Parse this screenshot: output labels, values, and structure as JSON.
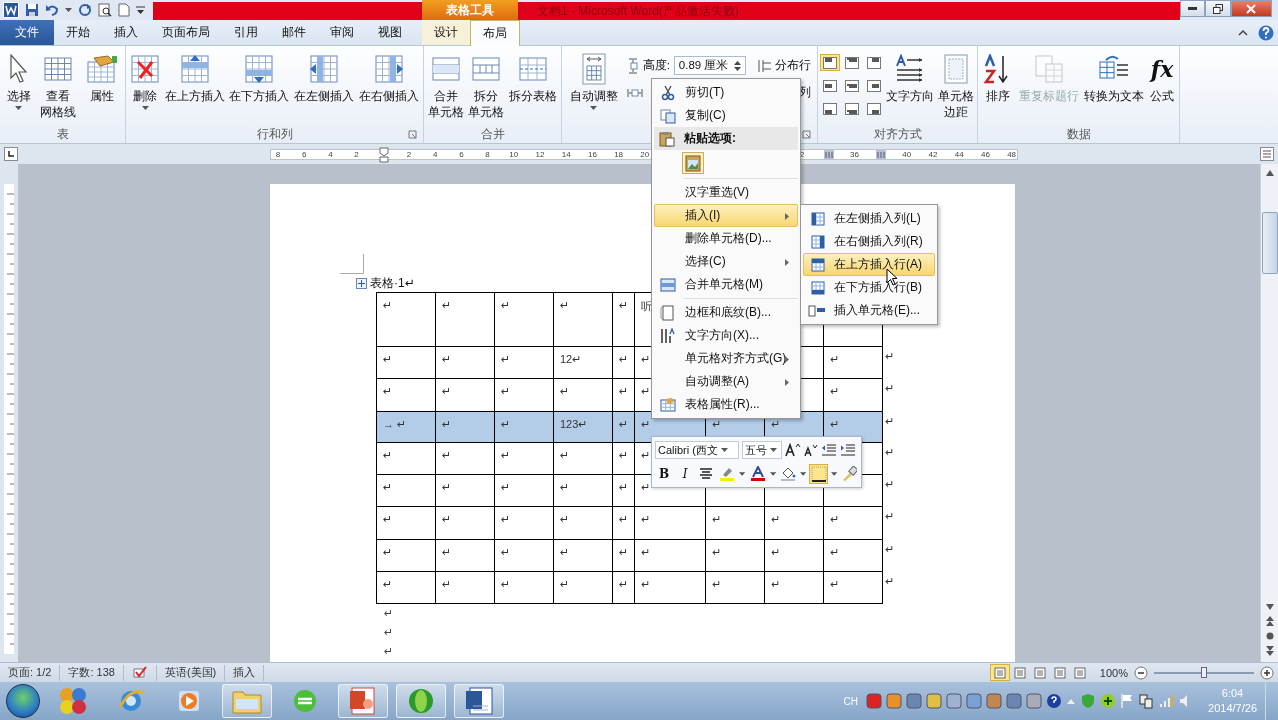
{
  "title_bar": {
    "context_label": "表格工具",
    "title": "文档1 - Microsoft Word(产品激活失败)"
  },
  "tabs": [
    {
      "label": "文件",
      "kind": "file",
      "selected": false
    },
    {
      "label": "开始",
      "kind": "normal",
      "selected": false
    },
    {
      "label": "插入",
      "kind": "normal",
      "selected": false
    },
    {
      "label": "页面布局",
      "kind": "normal",
      "selected": false
    },
    {
      "label": "引用",
      "kind": "normal",
      "selected": false
    },
    {
      "label": "邮件",
      "kind": "normal",
      "selected": false
    },
    {
      "label": "审阅",
      "kind": "normal",
      "selected": false
    },
    {
      "label": "视图",
      "kind": "normal",
      "selected": false
    },
    {
      "label": "设计",
      "kind": "contextual",
      "selected": false
    },
    {
      "label": "布局",
      "kind": "contextual",
      "selected": true
    }
  ],
  "ribbon": {
    "groups": [
      {
        "kind": "buttons",
        "label": "表",
        "launcher": false,
        "buttons": [
          {
            "label": "选择",
            "dropdown": true
          },
          {
            "label_lines": [
              "查看",
              "网格线"
            ]
          },
          {
            "label": "属性"
          }
        ]
      },
      {
        "kind": "buttons",
        "label": "行和列",
        "launcher": true,
        "buttons": [
          {
            "label": "删除",
            "dropdown": true
          },
          {
            "label": "在上方插入"
          },
          {
            "label": "在下方插入"
          },
          {
            "label": "在左侧插入"
          },
          {
            "label": "在右侧插入"
          }
        ]
      },
      {
        "kind": "buttons",
        "label": "合并",
        "launcher": false,
        "buttons": [
          {
            "label_lines": [
              "合并",
              "单元格"
            ]
          },
          {
            "label_lines": [
              "拆分",
              "单元格"
            ]
          },
          {
            "label": "拆分表格"
          }
        ]
      },
      {
        "kind": "cellsize",
        "launcher": true,
        "buttons": [
          {
            "label": "自动调整",
            "dropdown": true
          }
        ],
        "height_label": "高度:",
        "height_value": "0.89 厘米",
        "distribute_rows": "分布行",
        "distribute_cols": "列"
      },
      {
        "kind": "align",
        "label": "对齐方式",
        "launcher": false,
        "align_buttons": [
          {
            "selected": true
          },
          {
            "selected": false
          },
          {
            "selected": false
          },
          {
            "selected": false
          },
          {
            "selected": false
          },
          {
            "selected": false
          },
          {
            "selected": false
          },
          {
            "selected": false
          },
          {
            "selected": false
          }
        ],
        "buttons": [
          {
            "label": "文字方向"
          },
          {
            "label_lines": [
              "单元格",
              "边距"
            ]
          }
        ]
      },
      {
        "kind": "buttons",
        "label": "数据",
        "launcher": false,
        "buttons": [
          {
            "label": "排序",
            "disabled": false
          },
          {
            "label": "重复标题行",
            "disabled": true
          },
          {
            "label": "转换为文本",
            "disabled": false
          },
          {
            "label": "公式",
            "glyph": "fx",
            "disabled": false
          }
        ]
      }
    ]
  },
  "ruler": {
    "segments": [
      [
        "8",
        "6",
        "4",
        "2"
      ],
      [
        "2",
        "4",
        "6",
        "8",
        "10",
        "12",
        "14",
        "16",
        "18",
        "20"
      ],
      [
        "2"
      ],
      [
        "36"
      ],
      [
        "40",
        "42",
        "44",
        "46",
        "48"
      ]
    ]
  },
  "document": {
    "caption": "表格·1↵",
    "table": {
      "rows": [
        {
          "selected": false,
          "cells": [
            "↵",
            "↵",
            "↵",
            "↵",
            "↵",
            "听",
            null,
            null,
            null
          ],
          "end_mark": null
        },
        {
          "selected": false,
          "cells": [
            "↵",
            "↵",
            "↵",
            "12↵",
            "↵",
            "↵",
            null,
            null,
            "↵"
          ],
          "end_mark": "↵"
        },
        {
          "selected": false,
          "cells": [
            "↵",
            "↵",
            "↵",
            "↵",
            "↵",
            "↵",
            null,
            null,
            "↵"
          ],
          "end_mark": "↵"
        },
        {
          "selected": true,
          "cells": [
            "→ ↵",
            "↵",
            "↵",
            "123↵",
            "↵",
            "↵",
            "↵",
            "↵",
            "↵"
          ],
          "end_mark": "↵"
        },
        {
          "selected": false,
          "cells": [
            "↵",
            "↵",
            "↵",
            "↵",
            "↵",
            "↵",
            null,
            null,
            null
          ],
          "end_mark": "↵"
        },
        {
          "selected": false,
          "cells": [
            "↵",
            "↵",
            "↵",
            "↵",
            "↵",
            "↵",
            null,
            null,
            null
          ],
          "end_mark": "↵"
        },
        {
          "selected": false,
          "cells": [
            "↵",
            "↵",
            "↵",
            "↵",
            "↵",
            "↵",
            "↵",
            "↵",
            "↵"
          ],
          "end_mark": "↵"
        },
        {
          "selected": false,
          "cells": [
            "↵",
            "↵",
            "↵",
            "↵",
            "↵",
            "↵",
            "↵",
            "↵",
            "↵"
          ],
          "end_mark": "↵"
        },
        {
          "selected": false,
          "cells": [
            "↵",
            "↵",
            "↵",
            "↵",
            "↵",
            "↵",
            "↵",
            "↵",
            "↵"
          ],
          "end_mark": "↵"
        }
      ]
    },
    "after_marks": [
      "↵",
      "↵",
      "↵"
    ]
  },
  "context_menu": {
    "items": [
      {
        "kind": "item",
        "label": "剪切(T)",
        "selected": false,
        "submenu": false
      },
      {
        "kind": "item",
        "label": "复制(C)",
        "selected": false,
        "submenu": false
      },
      {
        "kind": "header",
        "label": "粘贴选项:"
      },
      {
        "kind": "paste_options"
      },
      {
        "kind": "separator"
      },
      {
        "kind": "item",
        "label": "汉字重选(V)",
        "selected": false,
        "submenu": false
      },
      {
        "kind": "item",
        "label": "插入(I)",
        "selected": true,
        "submenu": true
      },
      {
        "kind": "item",
        "label": "删除单元格(D)...",
        "selected": false,
        "submenu": false
      },
      {
        "kind": "item",
        "label": "选择(C)",
        "selected": false,
        "submenu": true
      },
      {
        "kind": "item",
        "label": "合并单元格(M)",
        "selected": false,
        "submenu": false
      },
      {
        "kind": "separator"
      },
      {
        "kind": "item",
        "label": "边框和底纹(B)...",
        "selected": false,
        "submenu": false
      },
      {
        "kind": "item",
        "label": "文字方向(X)...",
        "selected": false,
        "submenu": false
      },
      {
        "kind": "item",
        "label": "单元格对齐方式(G)",
        "selected": false,
        "submenu": true
      },
      {
        "kind": "item",
        "label": "自动调整(A)",
        "selected": false,
        "submenu": true
      },
      {
        "kind": "item",
        "label": "表格属性(R)...",
        "selected": false,
        "submenu": false
      }
    ]
  },
  "submenu": {
    "items": [
      {
        "label": "在左侧插入列(L)",
        "selected": false
      },
      {
        "label": "在右侧插入列(R)",
        "selected": false
      },
      {
        "label": "在上方插入行(A)",
        "selected": true
      },
      {
        "label": "在下方插入行(B)",
        "selected": false
      },
      {
        "label": "插入单元格(E)...",
        "selected": false
      }
    ]
  },
  "mini_toolbar": {
    "font": "Calibri (西文",
    "size": "五号",
    "format_buttons": [
      {
        "label": "B",
        "selected": false
      },
      {
        "label": "I",
        "selected": false
      }
    ],
    "tool_buttons": [
      {
        "selected": false,
        "dropdown": false
      },
      {
        "selected": false,
        "dropdown": true
      },
      {
        "selected": false,
        "dropdown": true
      },
      {
        "selected": false,
        "dropdown": true
      },
      {
        "selected": true,
        "dropdown": true
      },
      {
        "selected": false,
        "dropdown": false
      }
    ]
  },
  "status_bar": {
    "page": "页面: 1/2",
    "words": "字数: 138",
    "language": "英语(美国)",
    "mode": "插入",
    "views": [
      {
        "selected": true
      },
      {
        "selected": false
      },
      {
        "selected": false
      },
      {
        "selected": false
      },
      {
        "selected": false
      }
    ],
    "zoom": "100%",
    "zoom_slider": {
      "level": 0.5
    }
  },
  "taskbar": {
    "apps": [
      {
        "running": false
      },
      {
        "running": false
      },
      {
        "running": false
      },
      {
        "running": true
      },
      {
        "running": false
      },
      {
        "running": true
      },
      {
        "running": true
      },
      {
        "running": true
      }
    ],
    "input_indicator": "CH",
    "time": "6:04",
    "date": "2014/7/26"
  }
}
